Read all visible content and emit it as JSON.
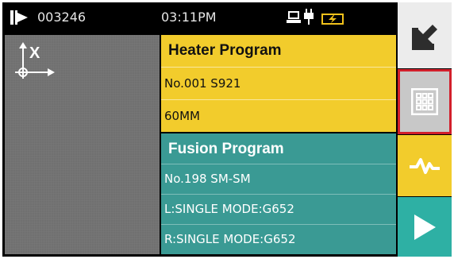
{
  "status_bar": {
    "counter": "003246",
    "time": "03:11PM",
    "icons": [
      "arc-counter-icon",
      "pc-connection-icon",
      "power-plug-icon",
      "battery-charging-icon"
    ]
  },
  "camera_view": {
    "axis_label": "X",
    "icons": [
      "xy-axis-icon"
    ]
  },
  "heater_program": {
    "title": "Heater Program",
    "line1": "No.001  S921",
    "line2": "60MM",
    "color": "#f2cc2c"
  },
  "fusion_program": {
    "title": "Fusion Program",
    "line1": "No.198  SM-SM",
    "line2": "L:SINGLE MODE:G652",
    "line3": "R:SINGLE MODE:G652",
    "color": "#3a9a94"
  },
  "side_buttons": [
    {
      "icon": "back-arrow-icon",
      "color": "#ececec"
    },
    {
      "icon": "grid-menu-icon",
      "color": "#c8c8c8",
      "selected": true,
      "selected_color": "#d21f2b"
    },
    {
      "icon": "waveform-icon",
      "color": "#f2cc2c"
    },
    {
      "icon": "play-icon",
      "color": "#2eb0a4"
    }
  ]
}
